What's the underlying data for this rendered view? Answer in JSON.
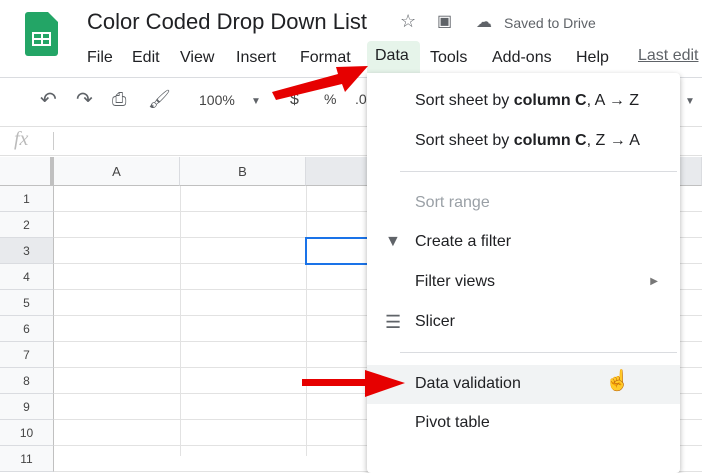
{
  "doc": {
    "title": "Color Coded Drop Down List",
    "saved": "Saved to Drive"
  },
  "menubar": [
    "File",
    "Edit",
    "View",
    "Insert",
    "Format",
    "Data",
    "Tools",
    "Add-ons",
    "Help"
  ],
  "last_edit": "Last edit",
  "toolbar": {
    "zoom": "100%",
    "currency": "$",
    "percent": "%",
    "decimal": ".0"
  },
  "formula": {
    "fx": "fx"
  },
  "columns": [
    "A",
    "B"
  ],
  "rows": [
    "1",
    "2",
    "3",
    "4",
    "5",
    "6",
    "7",
    "8",
    "9",
    "10",
    "11"
  ],
  "data_menu": {
    "sort_az_pre": "Sort sheet by ",
    "sort_az_bold": "column C",
    "sort_az_post": ", A → Z",
    "sort_za_pre": "Sort sheet by ",
    "sort_za_bold": "column C",
    "sort_za_post": ", Z → A",
    "sort_range": "Sort range",
    "create_filter": "Create a filter",
    "filter_views": "Filter views",
    "slicer": "Slicer",
    "data_validation": "Data validation",
    "pivot_table": "Pivot table"
  },
  "colors": {
    "accent": "#1a73e8",
    "arrow": "#e60000",
    "sheets_green": "#23a566"
  }
}
